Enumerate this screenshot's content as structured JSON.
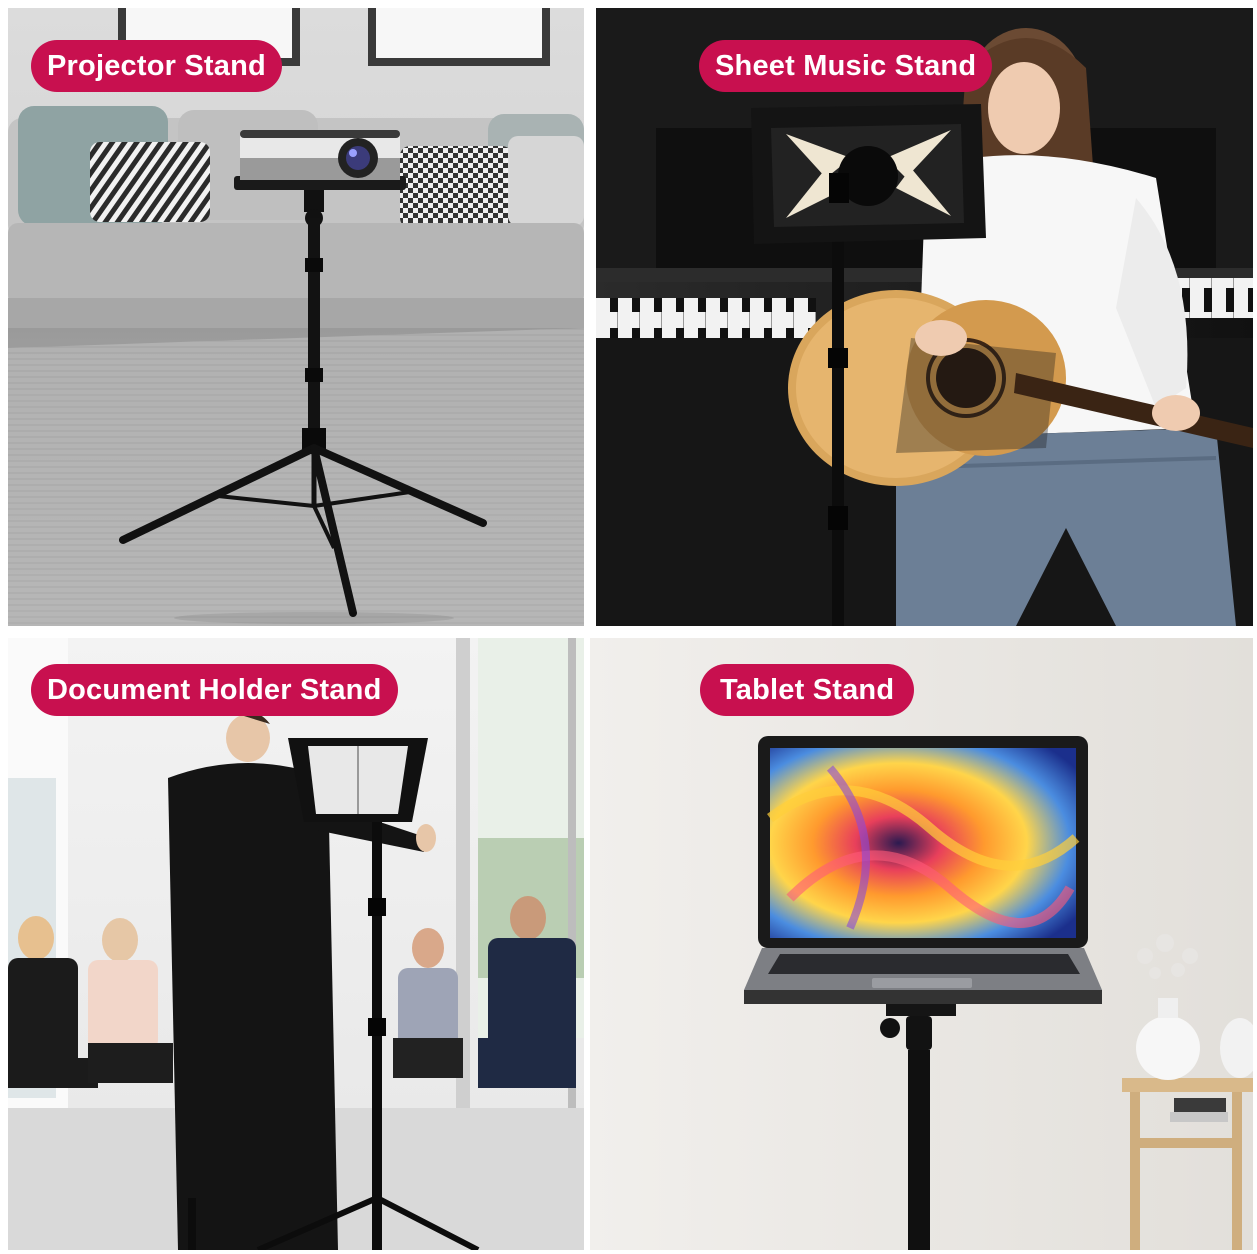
{
  "labels": {
    "projector": "Projector Stand",
    "sheet_music": "Sheet Music Stand",
    "document_holder": "Document Holder Stand",
    "tablet": "Tablet Stand"
  },
  "colors": {
    "label_bg": "#c8104f",
    "label_text": "#ffffff"
  }
}
